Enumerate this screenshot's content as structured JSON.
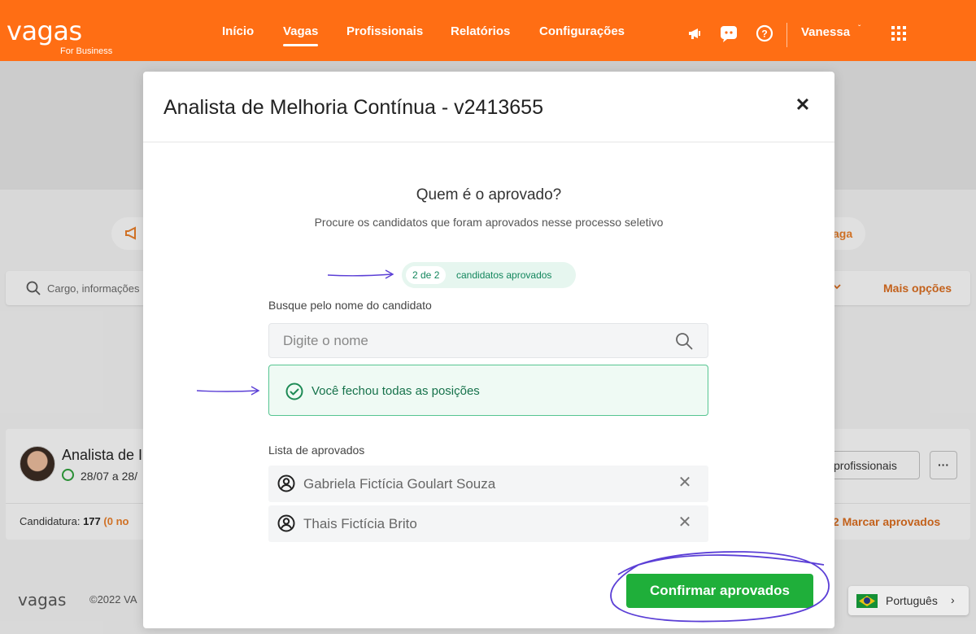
{
  "header": {
    "logo_word": "vagas",
    "logo_sub": "For Business",
    "nav": [
      {
        "label": "Início"
      },
      {
        "label": "Vagas"
      },
      {
        "label": "Profissionais"
      },
      {
        "label": "Relatórios"
      },
      {
        "label": "Configurações"
      }
    ],
    "active_nav": "Vagas",
    "user_name": "Vanessa",
    "brand_color": "#ff6e14"
  },
  "background": {
    "search_placeholder": "Cargo, informações",
    "more_options": "Mais opções",
    "job_title": "Analista de I",
    "job_dates": "28/07 a 28/",
    "candidatura_label": "Candidatura:",
    "candidatura_count": "177",
    "candidatura_extra": "(0 no",
    "profissionais_btn": "profissionais",
    "dots_btn": "···",
    "mark_approved": "/2 Marcar aprovados",
    "footer_logo": "vagas",
    "footer_copy": "©2022 VA",
    "language": "Português"
  },
  "modal": {
    "title": "Analista de Melhoria Contínua - v2413655",
    "question": "Quem é o aprovado?",
    "subtitle": "Procure os candidatos que foram aprovados nesse processo seletivo",
    "count_badge": "2 de 2",
    "count_text": "candidatos aprovados",
    "approved_count": 2,
    "approved_total": 2,
    "search_label": "Busque pelo nome do candidato",
    "search_placeholder": "Digite o nome",
    "search_value": "",
    "success_message": "Você fechou todas as posições",
    "list_label": "Lista de aprovados",
    "approved": [
      {
        "name": "Gabriela Fictícia Goulart Souza"
      },
      {
        "name": "Thais Fictícia Brito"
      }
    ],
    "confirm_label": "Confirmar aprovados",
    "confirm_color": "#1faf3a",
    "success_color": "#16724b",
    "annotation_color": "#5b3fd6"
  }
}
